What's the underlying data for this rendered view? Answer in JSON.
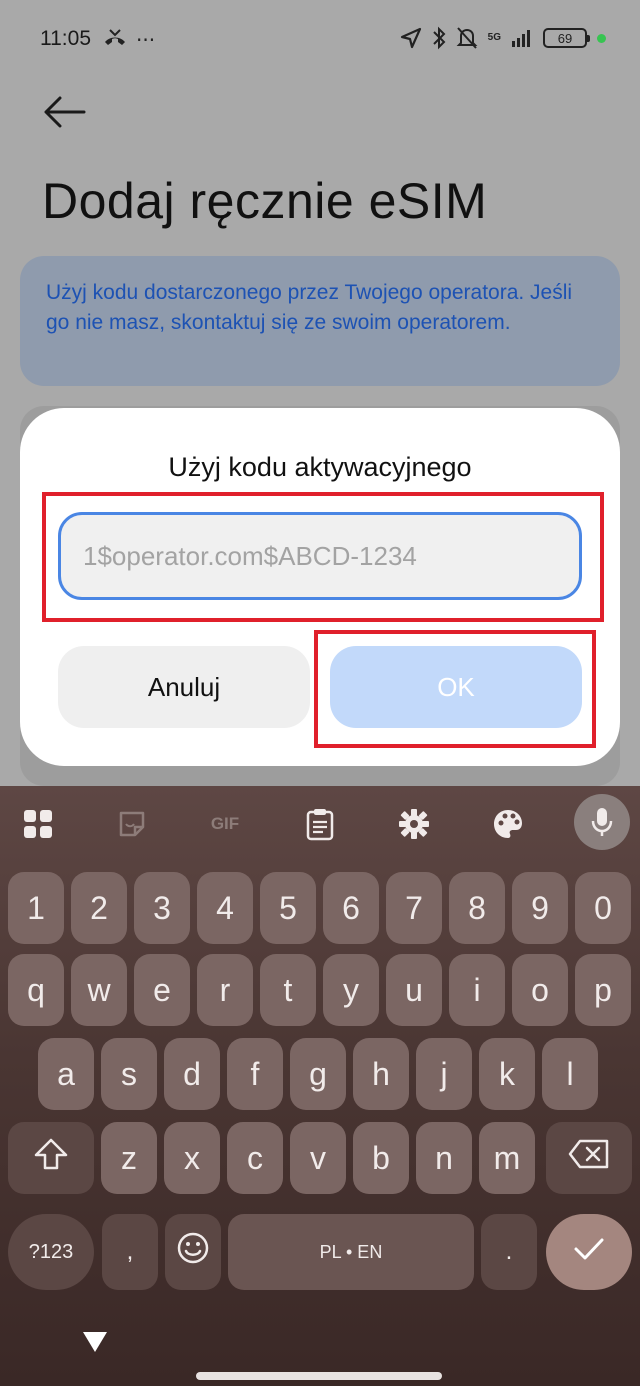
{
  "status_bar": {
    "time": "11:05",
    "more": "···",
    "network": "5G",
    "battery": "69"
  },
  "page": {
    "title": "Dodaj ręcznie eSIM",
    "info": "Użyj kodu dostarczonego przez Twojego operatora. Jeśli go nie masz, skontaktuj się ze swoim operatorem."
  },
  "dialog": {
    "title": "Użyj kodu aktywacyjnego",
    "input_placeholder": "1$operator.com$ABCD-1234",
    "input_value": "",
    "cancel_label": "Anuluj",
    "ok_label": "OK"
  },
  "keyboard": {
    "toolbar": [
      "grid-icon",
      "sticker-icon",
      "gif-icon",
      "clipboard-icon",
      "gear-icon",
      "palette-icon",
      "microphone-icon"
    ],
    "gif_label": "GIF",
    "row_numbers": [
      "1",
      "2",
      "3",
      "4",
      "5",
      "6",
      "7",
      "8",
      "9",
      "0"
    ],
    "row_1": [
      "q",
      "w",
      "e",
      "r",
      "t",
      "y",
      "u",
      "i",
      "o",
      "p"
    ],
    "row_2": [
      "a",
      "s",
      "d",
      "f",
      "g",
      "h",
      "j",
      "k",
      "l"
    ],
    "row_3": [
      "z",
      "x",
      "c",
      "v",
      "b",
      "n",
      "m"
    ],
    "symbols_label": "?123",
    "comma_label": ",",
    "space_label": "PL • EN",
    "period_label": "."
  },
  "colors": {
    "accent_blue": "#4a86e4",
    "ok_button": "#c2d9fa",
    "highlight_red": "#e0202b",
    "keyboard_bg": "#4a3633"
  }
}
